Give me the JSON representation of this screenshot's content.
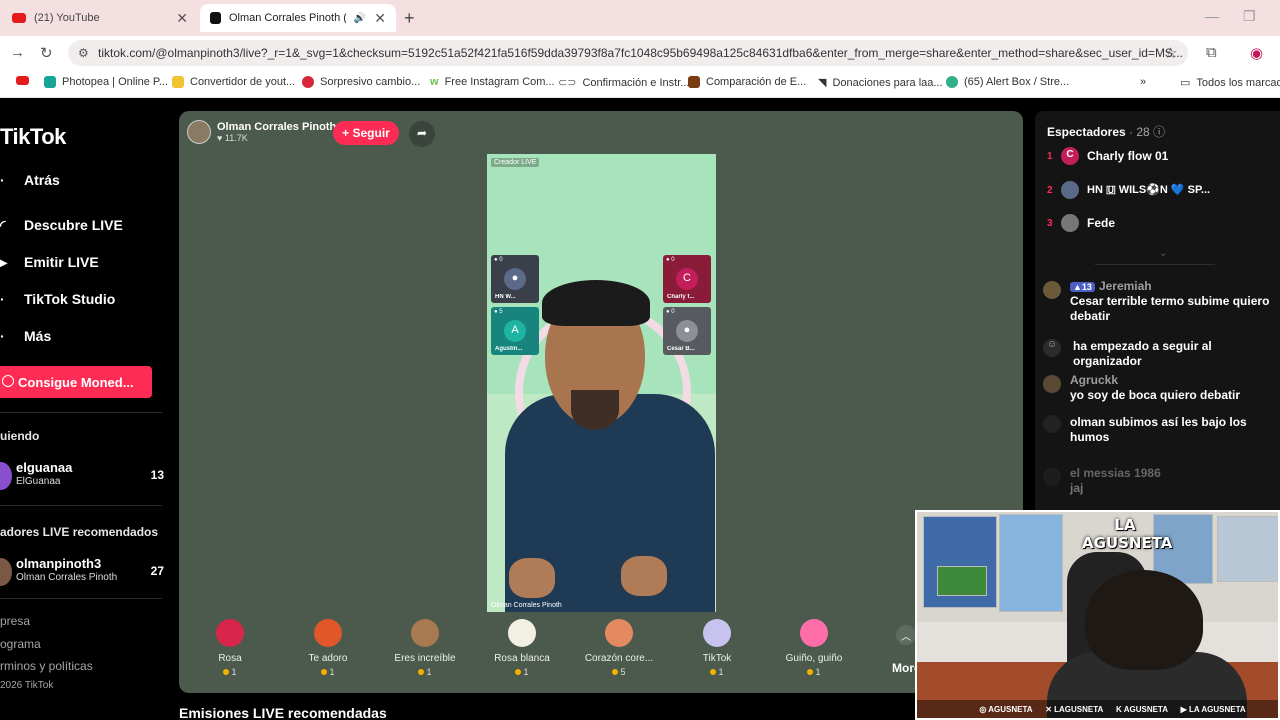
{
  "browser": {
    "tabs": [
      {
        "title": "(21) YouTube",
        "active": false
      },
      {
        "title": "Olman Corrales Pinoth (@c",
        "active": true
      }
    ],
    "url": "tiktok.com/@olmanpinoth3/live?_r=1&_svg=1&checksum=5192c51a52f421fa516f59dda39793f8a7fc1048c95b69498a125c84631dfba6&enter_from_merge=share&enter_method=share&sec_user_id=MS...",
    "bookmarks": [
      "Photopea | Online P...",
      "Convertidor de yout...",
      "Sorpresivo cambio...",
      "Free Instagram Com...",
      "Confirmación e Instr...",
      "Comparación de E...",
      "Donaciones para laa...",
      "(65) Alert Box / Stre..."
    ],
    "all_bookmarks": "Todos los marcado"
  },
  "tiktok": {
    "logo": "TikTok",
    "nav": {
      "back": "Atrás",
      "discover": "Descubre LIVE",
      "go_live": "Emitir LIVE",
      "studio": "TikTok Studio",
      "more": "Más"
    },
    "coins_button": "Consigue Moned...",
    "following_title": "uiendo",
    "following": [
      {
        "name": "elguanaa",
        "sub": "ElGuanaa",
        "count": "13"
      }
    ],
    "recommended_title": "adores LIVE recomendados",
    "recommended_hosts": [
      {
        "name": "olmanpinoth3",
        "sub": "Olman Corrales Pinoth",
        "count": "27"
      }
    ],
    "footer": [
      "presa",
      "ograma",
      "rminos y políticas",
      "2026 TikTok"
    ]
  },
  "stream": {
    "host_name": "Olman Corrales Pinoth",
    "host_likes": "11.7K",
    "follow": "+ Seguir",
    "tag": "Creador LIVE",
    "caption": "Olman Corrales Pinoth",
    "guests": [
      {
        "label": "HN W...",
        "viewers": "0"
      },
      {
        "label": "Charly f...",
        "viewers": "0"
      },
      {
        "label": "Agustin...",
        "viewers": "5"
      },
      {
        "label": "Cesar B...",
        "viewers": "0"
      }
    ],
    "gifts": [
      {
        "name": "Rosa",
        "price": "1",
        "color": "#d8264b"
      },
      {
        "name": "Te adoro",
        "price": "1",
        "color": "#e2572a"
      },
      {
        "name": "Eres increíble",
        "price": "1",
        "color": "#a87a52"
      },
      {
        "name": "Rosa blanca",
        "price": "1",
        "color": "#f2efe3"
      },
      {
        "name": "Corazón core...",
        "price": "5",
        "color": "#e38a60"
      },
      {
        "name": "TikTok",
        "price": "1",
        "color": "#c7c3ee"
      },
      {
        "name": "Guiño, guiño",
        "price": "1",
        "color": "#ff6ea8"
      }
    ],
    "more": "More"
  },
  "recommended_section": "Emisiones LIVE recomendadas",
  "spectators": {
    "title": "Espectadores",
    "count": "· 28",
    "top": [
      {
        "rank": "1",
        "name": "Charly flow 01"
      },
      {
        "rank": "2",
        "name": "HN 🇺 WILS⚽N 💙 SP..."
      },
      {
        "rank": "3",
        "name": "Fede"
      }
    ]
  },
  "chat": [
    {
      "name": "Jeremiah",
      "level": "13",
      "message": "Cesar terrible termo subime quiero debatir"
    },
    {
      "name": "",
      "message": "ha empezado a seguir al organizador"
    },
    {
      "name": "Agruckk",
      "message": "yo soy de boca quiero debatir"
    },
    {
      "name": "",
      "message": "olman subimos así les bajo los humos"
    },
    {
      "name": "el messias 1986",
      "message": "jaj"
    }
  ],
  "webcam": {
    "logo": "LA AGUSNETA",
    "socials": [
      "AGUSNETA",
      "LAGUSNETA",
      "AGUSNETA",
      "LA AGUSNETA"
    ]
  },
  "colors": {
    "accent": "#fe2c55",
    "player_bg": "#4b5a4d"
  }
}
